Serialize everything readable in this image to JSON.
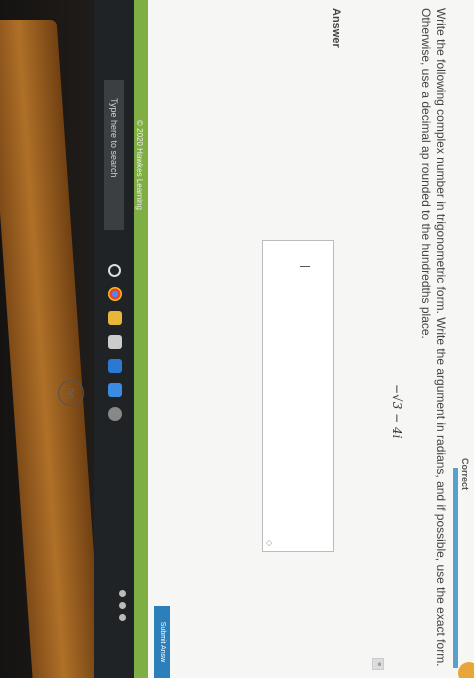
{
  "header": {
    "status": "Correct"
  },
  "question": {
    "prompt": "Write the following complex number in trigonometric form. Write the argument in radians, and if possible, use the exact form. Otherwise, use a decimal ap rounded to the hundredths place.",
    "expression": "−√3 − 4i"
  },
  "answer": {
    "label": "Answer",
    "value": ""
  },
  "actions": {
    "submit_label": "Submit Answ"
  },
  "footer": {
    "copyright": "© 2020 Hawkes Learning"
  },
  "taskbar": {
    "search_placeholder": "Type here to search",
    "icons": [
      "task-view-icon",
      "chrome-icon",
      "file-explorer-icon",
      "store-icon",
      "mail-icon",
      "dropbox-icon",
      "settings-icon"
    ]
  },
  "colors": {
    "accent": "#2c7fb8",
    "footer": "#7fae44",
    "taskbar": "#1f2326"
  }
}
